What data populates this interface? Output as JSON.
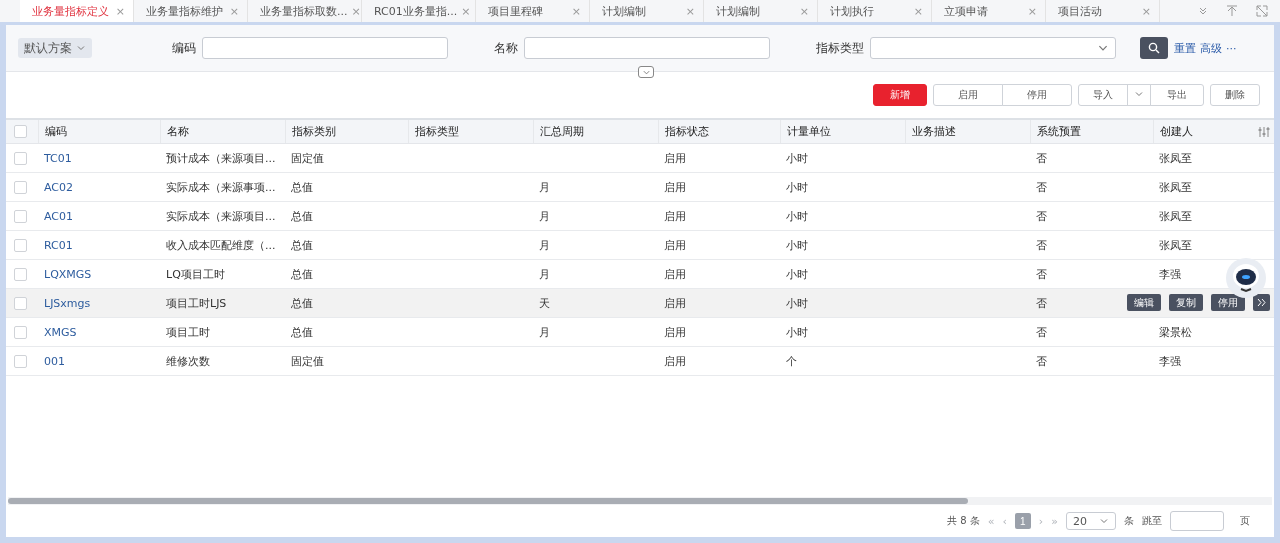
{
  "tabs": [
    {
      "label": "业务量指标定义",
      "close": "×",
      "selected": true
    },
    {
      "label": "业务量指标维护",
      "close": "×",
      "selected": false
    },
    {
      "label": "业务量指标取数...",
      "close": "×",
      "selected": false
    },
    {
      "label": "RC01业务量指...",
      "close": "×",
      "selected": false
    },
    {
      "label": "项目里程碑",
      "close": "×",
      "selected": false
    },
    {
      "label": "计划编制",
      "close": "×",
      "selected": false
    },
    {
      "label": "计划编制",
      "close": "×",
      "selected": false
    },
    {
      "label": "计划执行",
      "close": "×",
      "selected": false
    },
    {
      "label": "立项申请",
      "close": "×",
      "selected": false
    },
    {
      "label": "项目活动",
      "close": "×",
      "selected": false
    }
  ],
  "filter": {
    "scheme": "默认方案",
    "fields": [
      {
        "label": "编码",
        "kind": "text"
      },
      {
        "label": "名称",
        "kind": "text"
      },
      {
        "label": "指标类型",
        "kind": "select"
      }
    ],
    "reset": "重置",
    "advanced": "高级",
    "more": "···"
  },
  "toolbar": {
    "buttons": [
      {
        "label": "新增",
        "kind": "primary"
      },
      {
        "label": "启用",
        "kind": "group-start"
      },
      {
        "label": "停用",
        "kind": "group-end"
      },
      {
        "label": "导入",
        "kind": "split"
      },
      {
        "label": "导出",
        "kind": "split-end"
      },
      {
        "label": "删除",
        "kind": "plain"
      }
    ]
  },
  "table": {
    "all_checked": false,
    "columns": [
      "编码",
      "名称",
      "指标类别",
      "指标类型",
      "汇总周期",
      "指标状态",
      "计量单位",
      "业务描述",
      "系统预置",
      "创建人"
    ],
    "rows": [
      {
        "cells": [
          "TC01",
          "预计成本（来源项目...",
          "固定值",
          "",
          "",
          "启用",
          "小时",
          "",
          "否",
          "张凤至"
        ],
        "checked": false,
        "hovered": false
      },
      {
        "cells": [
          "AC02",
          "实际成本（来源事项...",
          "总值",
          "",
          "月",
          "启用",
          "小时",
          "",
          "否",
          "张凤至"
        ],
        "checked": false,
        "hovered": false
      },
      {
        "cells": [
          "AC01",
          "实际成本（来源项目...",
          "总值",
          "",
          "月",
          "启用",
          "小时",
          "",
          "否",
          "张凤至"
        ],
        "checked": false,
        "hovered": false
      },
      {
        "cells": [
          "RC01",
          "收入成本匹配维度（...",
          "总值",
          "",
          "月",
          "启用",
          "小时",
          "",
          "否",
          "张凤至"
        ],
        "checked": false,
        "hovered": false
      },
      {
        "cells": [
          "LQXMGS",
          "LQ项目工时",
          "总值",
          "",
          "月",
          "启用",
          "小时",
          "",
          "否",
          "李强"
        ],
        "checked": false,
        "hovered": false
      },
      {
        "cells": [
          "LJSxmgs",
          "项目工时LJS",
          "总值",
          "",
          "天",
          "启用",
          "小时",
          "",
          "否",
          ""
        ],
        "checked": false,
        "hovered": true
      },
      {
        "cells": [
          "XMGS",
          "项目工时",
          "总值",
          "",
          "月",
          "启用",
          "小时",
          "",
          "否",
          "梁景松"
        ],
        "checked": false,
        "hovered": false
      },
      {
        "cells": [
          "001",
          "维修次数",
          "固定值",
          "",
          "",
          "启用",
          "个",
          "",
          "否",
          "李强"
        ],
        "checked": false,
        "hovered": false
      }
    ],
    "row_actions": [
      "编辑",
      "复制",
      "停用"
    ]
  },
  "pagination": {
    "total": "共 8 条",
    "first": "«",
    "prev": "‹",
    "page": "1",
    "next": "›",
    "last": "»",
    "page_size": "20",
    "unit": "条",
    "jump": "跳至",
    "page_word": "页"
  }
}
